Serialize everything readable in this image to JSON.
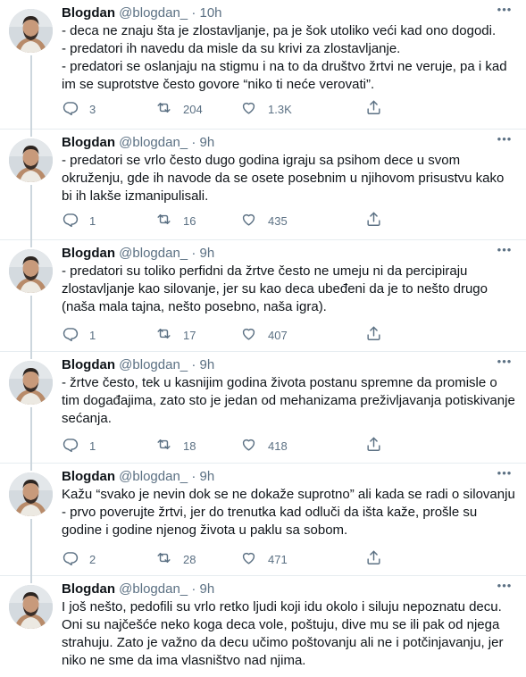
{
  "tweets": [
    {
      "name": "Blogdan",
      "handle": "@blogdan_",
      "separator": "·",
      "time": "10h",
      "lines": [
        "- deca ne znaju šta je zlostavljanje, pa je šok utoliko veći kad ono dogodi.",
        "- predatori ih navedu da misle da su krivi za zlostavljanje.",
        "- predatori se oslanjaju na stigmu i na to da društvo žrtvi ne veruje, pa i kad",
        "im se suprotstve često govore “niko ti neće verovati”."
      ],
      "replies": "3",
      "retweets": "204",
      "likes": "1.3K"
    },
    {
      "name": "Blogdan",
      "handle": "@blogdan_",
      "separator": "·",
      "time": "9h",
      "lines": [
        "- predatori se vrlo često dugo godina igraju sa psihom dece u svom",
        "okruženju, gde ih navode da se osete posebnim u njihovom prisustvu kako",
        "bi ih lakše izmanipulisali."
      ],
      "replies": "1",
      "retweets": "16",
      "likes": "435"
    },
    {
      "name": "Blogdan",
      "handle": "@blogdan_",
      "separator": "·",
      "time": "9h",
      "lines": [
        "- predatori su toliko perfidni da žrtve često ne umeju ni da percipiraju",
        "zlostavljanje kao silovanje, jer su kao deca ubeđeni da je to nešto drugo",
        "(naša mala tajna, nešto posebno, naša igra)."
      ],
      "replies": "1",
      "retweets": "17",
      "likes": "407"
    },
    {
      "name": "Blogdan",
      "handle": "@blogdan_",
      "separator": "·",
      "time": "9h",
      "lines": [
        "- žrtve često, tek u kasnijim godina života postanu spremne da promisle o",
        "tim događajima, zato sto je jedan od mehanizama preživljavanja potiskivanje",
        "sećanja."
      ],
      "replies": "1",
      "retweets": "18",
      "likes": "418"
    },
    {
      "name": "Blogdan",
      "handle": "@blogdan_",
      "separator": "·",
      "time": "9h",
      "lines": [
        "Kažu “svako je nevin dok se ne dokaže suprotno” ali kada se radi o silovanju",
        "- prvo poverujte žrtvi, jer do trenutka kad odluči da išta kaže, prošle su",
        "godine i godine njenog života u paklu sa sobom."
      ],
      "replies": "2",
      "retweets": "28",
      "likes": "471"
    },
    {
      "name": "Blogdan",
      "handle": "@blogdan_",
      "separator": "·",
      "time": "9h",
      "lines": [
        "I još nešto, pedofili su vrlo retko ljudi koji idu okolo i siluju nepoznatu decu.",
        "Oni su najčešće neko koga deca vole, poštuju, dive mu se ili pak od njega",
        "strahuju. Zato je važno da decu učimo poštovanju ali ne i potčinjavanju, jer",
        "niko ne sme da ima vlasništvo nad njima."
      ],
      "replies": "",
      "retweets": "",
      "likes": ""
    }
  ],
  "icons": {
    "reply": "reply-icon",
    "retweet": "retweet-icon",
    "like": "heart-icon",
    "share": "share-icon",
    "more": "more-icon"
  },
  "colors": {
    "text": "#0f1419",
    "secondary": "#5b7083",
    "divider": "#e6ecf0"
  }
}
